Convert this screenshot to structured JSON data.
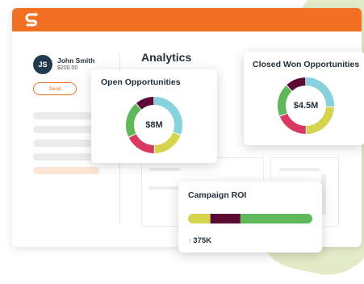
{
  "colors": {
    "brand_orange": "#f27021",
    "slice_teal": "#86d3de",
    "slice_yellow": "#d6d34c",
    "slice_crimson": "#d93a63",
    "slice_green": "#60b85c",
    "slice_maroon": "#5a0a33"
  },
  "icons": {
    "logo": "brand-s-logo-icon"
  },
  "user": {
    "initials": "JS",
    "name": "John Smith",
    "amount": "$200.00"
  },
  "sidebar": {
    "send_label": "Send"
  },
  "main": {
    "title": "Analytics"
  },
  "cards": {
    "open": {
      "title": "Open Opportunities",
      "value": "$8M"
    },
    "closed": {
      "title": "Closed Won Opportunities",
      "value": "$4.5M"
    },
    "roi": {
      "title": "Campaign ROI",
      "value": "375K",
      "arrow": "↑"
    }
  },
  "chart_data": [
    {
      "type": "pie",
      "title": "Open Opportunities",
      "center_label": "$8M",
      "slices": [
        {
          "color": "#86d3de",
          "value": 31
        },
        {
          "color": "#d6d34c",
          "value": 19
        },
        {
          "color": "#d93a63",
          "value": 18
        },
        {
          "color": "#60b85c",
          "value": 21
        },
        {
          "color": "#5a0a33",
          "value": 11
        }
      ]
    },
    {
      "type": "pie",
      "title": "Closed Won Opportunities",
      "center_label": "$4.5M",
      "slices": [
        {
          "color": "#86d3de",
          "value": 26
        },
        {
          "color": "#d6d34c",
          "value": 24
        },
        {
          "color": "#d93a63",
          "value": 19
        },
        {
          "color": "#60b85c",
          "value": 19
        },
        {
          "color": "#5a0a33",
          "value": 12
        }
      ]
    },
    {
      "type": "bar",
      "title": "Campaign ROI",
      "value_label": "375K",
      "segments": [
        {
          "color": "#d6d34c",
          "value": 18
        },
        {
          "color": "#5a0a33",
          "value": 24
        },
        {
          "color": "#60b85c",
          "value": 58
        }
      ]
    }
  ]
}
